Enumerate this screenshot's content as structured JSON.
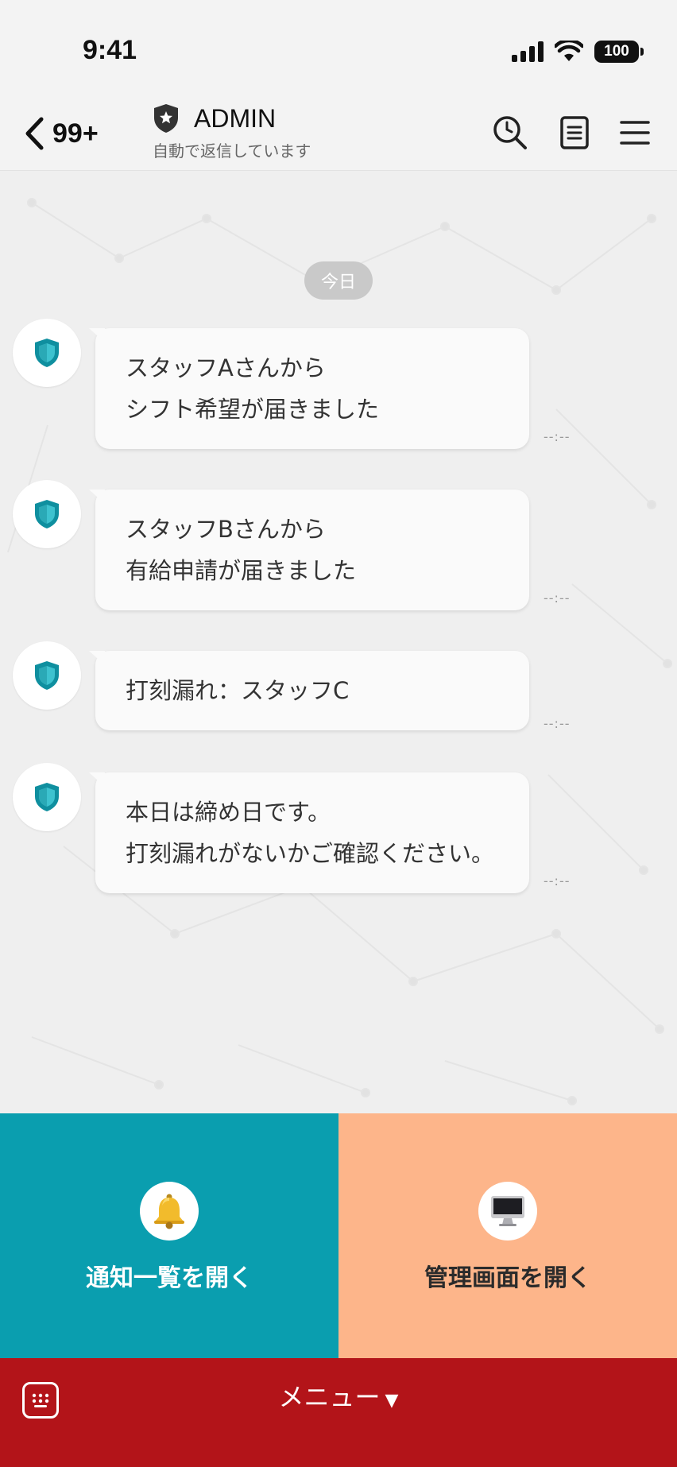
{
  "status_bar": {
    "time": "9:41",
    "battery": "100",
    "icons": [
      "cellular-signal-icon",
      "wifi-icon",
      "battery-icon"
    ]
  },
  "header": {
    "back_count": "99+",
    "title": "ADMIN",
    "subtitle": "自動で返信しています",
    "icons": [
      "shield-star-icon",
      "search-clock-icon",
      "notes-icon",
      "menu-icon"
    ]
  },
  "chat": {
    "date_label": "今日",
    "messages": [
      {
        "lines": [
          "スタッフAさんから",
          "シフト希望が届きました"
        ],
        "time": "--:--"
      },
      {
        "lines": [
          "スタッフBさんから",
          "有給申請が届きました"
        ],
        "time": "--:--"
      },
      {
        "lines": [
          "打刻漏れ：スタッフC"
        ],
        "time": "--:--"
      },
      {
        "lines": [
          "本日は締め日です。",
          "打刻漏れがないかご確認ください。"
        ],
        "time": "--:--"
      }
    ]
  },
  "rich_menu": {
    "left": {
      "label": "通知一覧を開く",
      "icon": "bell-icon",
      "color": "#0a9eaf"
    },
    "right": {
      "label": "管理画面を開く",
      "icon": "desktop-computer-icon",
      "color": "#fdb58a"
    }
  },
  "bottom_bar": {
    "menu_label": "メニュー",
    "menu_arrow": "▼",
    "color": "#b31419"
  }
}
